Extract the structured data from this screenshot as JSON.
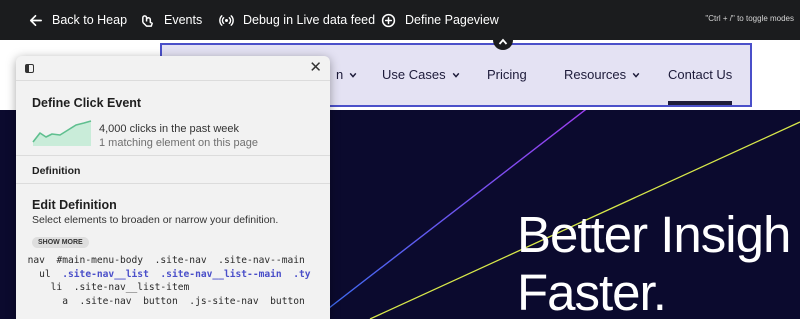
{
  "toolbar": {
    "back_label": "Back to Heap",
    "events_label": "Events",
    "debug_label": "Debug in Live data feed",
    "define_label": "Define Pageview",
    "hint": "\"Ctrl + /\" to toggle modes",
    "icons": [
      "arrow-left-icon",
      "events-icon",
      "broadcast-icon",
      "plus-circle-icon"
    ]
  },
  "site_nav": {
    "items": [
      {
        "label": "n",
        "has_dropdown": true
      },
      {
        "label": "Use Cases",
        "has_dropdown": true
      },
      {
        "label": "Pricing",
        "has_dropdown": false
      },
      {
        "label": "Resources",
        "has_dropdown": true
      },
      {
        "label": "Contact Us",
        "has_dropdown": false
      }
    ],
    "highlight_color": "#4a4fc9"
  },
  "hero": {
    "line1": "Better Insigh",
    "line2": "Faster.",
    "background": "#0b0a2e"
  },
  "panel": {
    "title": "Define Click Event",
    "clicks": "4,000 clicks in the past week",
    "matching": "1 matching element on this page",
    "definition_label": "Definition",
    "edit_title": "Edit Definition",
    "edit_subtitle": "Select elements to broaden or narrow your definition.",
    "show_more": "SHOW MORE",
    "sparkline_color": "#5fbf8f",
    "code_lines": [
      {
        "indent": "  ",
        "parts": [
          {
            "text": "nav  #main-menu-body  .site-nav  .site-nav--main",
            "hl": false
          }
        ]
      },
      {
        "indent": "    ",
        "parts": [
          {
            "text": "ul  ",
            "hl": false
          },
          {
            "text": ".site-nav__list  .site-nav__list--main  .ty",
            "hl": true
          }
        ]
      },
      {
        "indent": "      ",
        "parts": [
          {
            "text": "li  .site-nav__list-item",
            "hl": false
          }
        ]
      },
      {
        "indent": "        ",
        "parts": [
          {
            "text": "a  .site-nav  button  .js-site-nav  button",
            "hl": false
          }
        ]
      }
    ]
  }
}
